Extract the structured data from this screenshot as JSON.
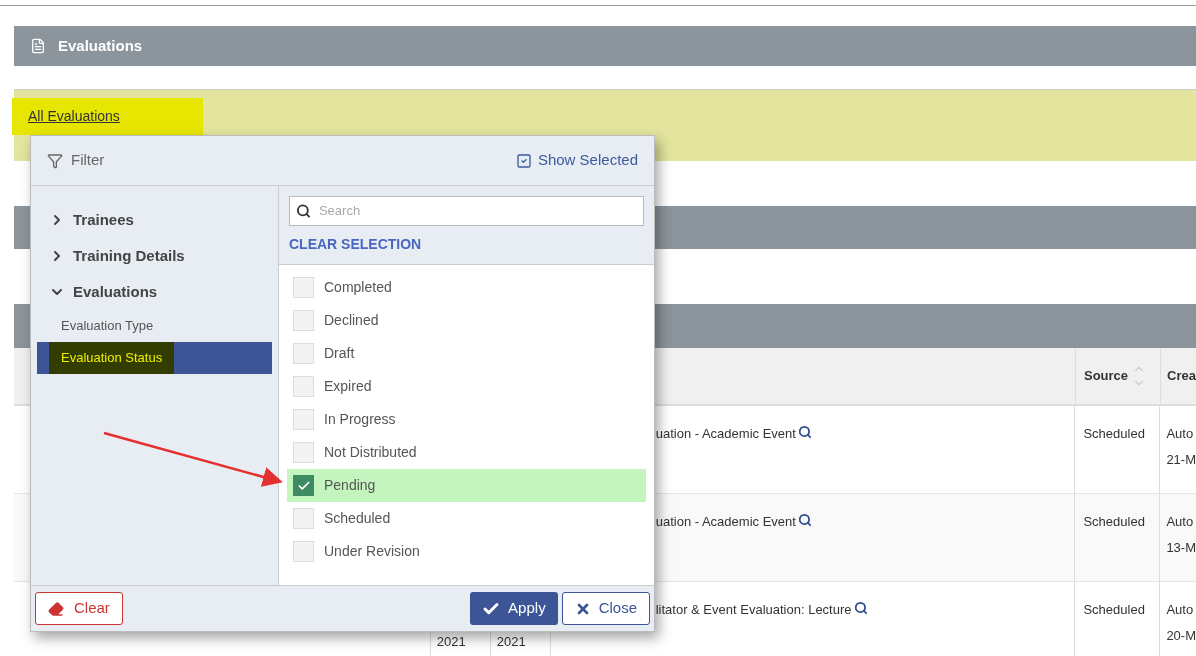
{
  "page_header": {
    "title": "Evaluations"
  },
  "breadcrumb": {
    "label": "All Evaluations"
  },
  "table": {
    "columns": [
      {
        "label": "Source"
      },
      {
        "label": "Crea"
      }
    ],
    "rows": [
      {
        "title": "uation - Academic Event",
        "dates": [],
        "source": "Scheduled",
        "created": [
          "Auto",
          "21-M"
        ]
      },
      {
        "title": "uation - Academic Event",
        "dates": [],
        "source": "Scheduled",
        "created": [
          "Auto",
          "13-M"
        ]
      },
      {
        "title": "litator & Event Evaluation: Lecture",
        "dates": [
          "2021",
          "2021"
        ],
        "source": "Scheduled",
        "created": [
          "Auto",
          "20-M"
        ]
      }
    ]
  },
  "filter": {
    "title": "Filter",
    "show_selected": {
      "label": "Show Selected",
      "checked": true
    },
    "tree": [
      {
        "label": "Trainees",
        "expanded": false
      },
      {
        "label": "Training Details",
        "expanded": false
      },
      {
        "label": "Evaluations",
        "expanded": true,
        "children": [
          {
            "label": "Evaluation Type",
            "selected": false
          },
          {
            "label": "Evaluation Status",
            "selected": true
          }
        ]
      }
    ],
    "search": {
      "placeholder": "Search"
    },
    "clear_selection": "CLEAR SELECTION",
    "options": [
      {
        "label": "Completed",
        "checked": false
      },
      {
        "label": "Declined",
        "checked": false
      },
      {
        "label": "Draft",
        "checked": false
      },
      {
        "label": "Expired",
        "checked": false
      },
      {
        "label": "In Progress",
        "checked": false
      },
      {
        "label": "Not Distributed",
        "checked": false
      },
      {
        "label": "Pending",
        "checked": true
      },
      {
        "label": "Scheduled",
        "checked": false
      },
      {
        "label": "Under Revision",
        "checked": false
      }
    ],
    "buttons": {
      "clear": "Clear",
      "apply": "Apply",
      "close": "Close"
    }
  }
}
